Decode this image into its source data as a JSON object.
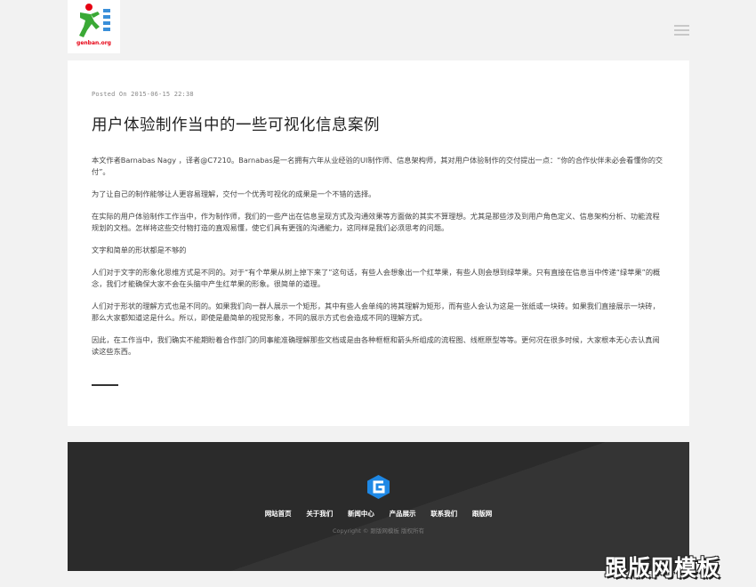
{
  "header": {
    "logo_text": "genban.org"
  },
  "article": {
    "posted_on": "Posted On 2015-06-15 22:38",
    "title": "用户体验制作当中的一些可视化信息案例",
    "paragraphs": [
      "本文作者Barnabas Nagy ，译者@C7210。Barnabas是一名拥有六年从业经验的UI制作师、信息架构师，其对用户体验制作的交付提出一点：“你的合作伙伴未必会看懂你的交付”。",
      "为了让自己的制作能够让人更容易理解，交付一个优秀可视化的成果是一个不错的选择。",
      "在实际的用户体验制作工作当中，作为制作师，我们的一些产出在信息呈现方式及沟通效果等方面做的其实不算理想。尤其是那些涉及到用户角色定义、信息架构分析、功能流程规划的文档。怎样将这些交付物打造的直观易懂，使它们具有更强的沟通能力，这同样是我们必须思考的问题。",
      "文字和简单的形状都是不够的",
      "人们对于文字的形象化思维方式是不同的。对于“有个苹果从树上掉下来了”这句话，有些人会想象出一个红苹果，有些人则会想到绿苹果。只有直接在信息当中传递“绿苹果”的概念，我们才能确保大家不会在头脑中产生红苹果的形象。很简单的道理。",
      "人们对于形状的理解方式也是不同的。如果我们向一群人展示一个矩形，其中有些人会单纯的将其理解为矩形，而有些人会认为这是一张纸或一块砖。如果我们直接展示一块砖，那么大家都知道这是什么。所以，即使是最简单的视觉形象，不同的展示方式也会造成不同的理解方式。",
      "因此，在工作当中，我们确实不能期盼着合作部门的同事能准确理解那些文档或是由各种框框和箭头所组成的流程图、线框原型等等。更何况在很多时候，大家根本无心去认真阅读这些东西。"
    ]
  },
  "footer": {
    "nav": [
      "网站首页",
      "关于我们",
      "新闻中心",
      "产品展示",
      "联系我们",
      "跟版网"
    ],
    "copyright": "Copyright © 跟版网模板 版权所有"
  },
  "watermark": "跟版网模板",
  "colors": {
    "page_bg": "#f2f2f2",
    "footer_bg": "#2b2b2b",
    "footer_logo": "#1e88e5",
    "logo_green": "#3aa935",
    "logo_red": "#e60012"
  },
  "icons": {
    "menu": "hamburger-menu-icon",
    "logo": "running-man-logo",
    "footer_logo": "hexagon-g-logo"
  }
}
